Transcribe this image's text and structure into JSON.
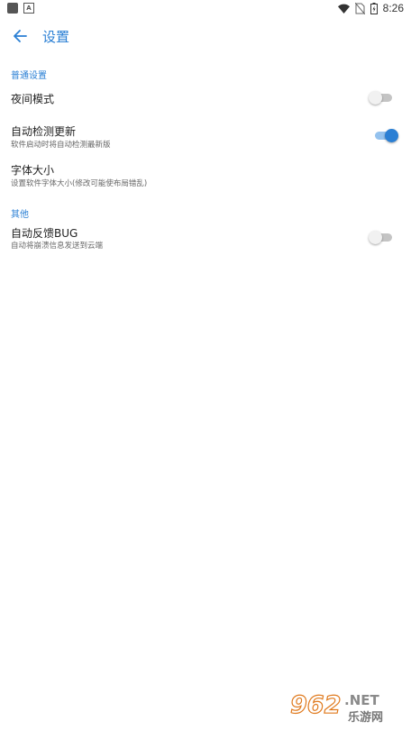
{
  "status_bar": {
    "time": "8:26",
    "icons": [
      "app-icon",
      "a-notification-icon",
      "wifi-icon",
      "no-sim-icon",
      "battery-icon"
    ]
  },
  "toolbar": {
    "back_icon": "arrow-left-icon",
    "title": "设置"
  },
  "sections": {
    "general": {
      "header": "普通设置",
      "night_mode": {
        "title": "夜间模式",
        "enabled": false
      },
      "auto_update": {
        "title": "自动检测更新",
        "summary": "软件启动时将自动检测最新版",
        "enabled": true
      },
      "font_size": {
        "title": "字体大小",
        "summary": "设置软件字体大小(修改可能使布局错乱)"
      }
    },
    "other": {
      "header": "其他",
      "bug_report": {
        "title": "自动反馈BUG",
        "summary": "自动将崩溃信息发送到云端",
        "enabled": false
      }
    }
  },
  "watermark": {
    "number": "962",
    "suffix": ".NET",
    "caption": "乐游网"
  },
  "colors": {
    "accent": "#2a7fd4",
    "accent_track": "#94c2ee",
    "switch_off_track": "#c4c4c4",
    "switch_off_thumb": "#f1f1f1",
    "title_text": "#222222",
    "summary_text": "#666666"
  }
}
